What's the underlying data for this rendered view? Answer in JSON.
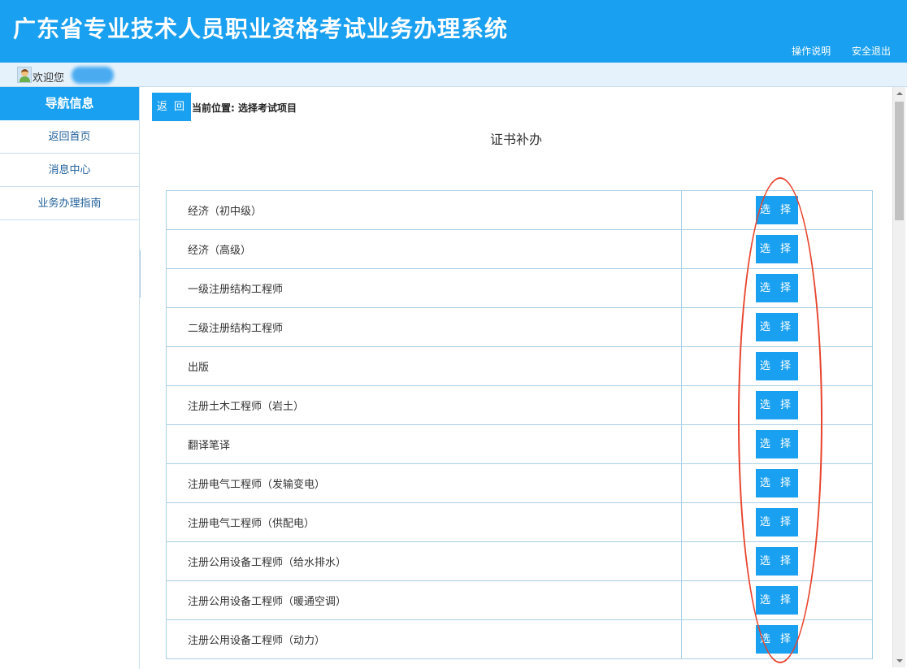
{
  "header": {
    "title": "广东省专业技术人员职业资格考试业务办理系统",
    "links": [
      "操作说明",
      "安全退出"
    ]
  },
  "welcome": {
    "text": "欢迎您"
  },
  "sidebar": {
    "title": "导航信息",
    "items": [
      {
        "label": "返回首页"
      },
      {
        "label": "消息中心"
      },
      {
        "label": "业务办理指南"
      }
    ]
  },
  "main": {
    "back_label": "返 回",
    "breadcrumb": "当前位置: 选择考试项目",
    "heading": "证书补办",
    "select_label": "选 择",
    "exams": [
      "经济（初中级）",
      "经济（高级）",
      "一级注册结构工程师",
      "二级注册结构工程师",
      "出版",
      "注册土木工程师（岩土）",
      "翻译笔译",
      "注册电气工程师（发输变电）",
      "注册电气工程师（供配电）",
      "注册公用设备工程师（给水排水）",
      "注册公用设备工程师（暖通空调）",
      "注册公用设备工程师（动力）"
    ]
  },
  "colors": {
    "primary": "#1aa0f0",
    "highlight_ring": "#e8432c"
  },
  "icons": [
    "user-avatar-icon",
    "collapse-arrow-icon"
  ]
}
